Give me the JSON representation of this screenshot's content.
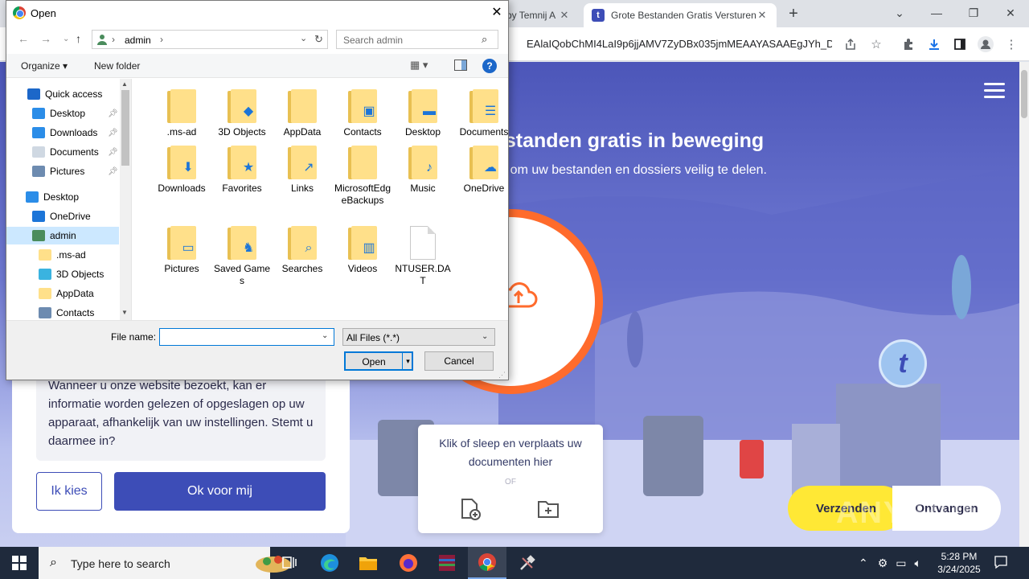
{
  "browser": {
    "tabs": [
      {
        "label": "by Temnij A",
        "active": false
      },
      {
        "label": "Grote Bestanden Gratis Versturen",
        "active": true
      }
    ],
    "new_tab": "+",
    "favicon_letter": "t",
    "window_controls": {
      "minimize": "—",
      "restore": "❐",
      "close": "✕",
      "dropdown": "⌄"
    },
    "url": "EAlaIQobChMI4LaI9p6jjAMV7ZyDBx035jmMEAAYASAAEgJYh_D...",
    "icons": [
      "share-icon",
      "star-icon",
      "extensions-icon",
      "download-icon",
      "sidepanel-icon",
      "profile-icon",
      "menu-icon"
    ]
  },
  "page": {
    "hero_title": "estanden gratis in beweging",
    "hero_subtitle": "er om uw bestanden en dossiers veilig te delen.",
    "logo_letter": "t",
    "drop_text": "Klik of sleep en verplaats uw documenten hier",
    "drop_or": "OF",
    "btn_verzenden": "Verzenden",
    "btn_ontvangen": "Ontvangen",
    "cookie_text": "Wanneer u onze website bezoekt, kan er informatie worden gelezen of opgeslagen op uw apparaat, afhankelijk van uw instellingen. Stemt u daarmee in?",
    "btn_ik_kies": "Ik kies",
    "btn_ok": "Ok voor mij",
    "watermark": "ANY RUN",
    "accent": "#3d4db7",
    "orange": "#ff6b2c",
    "yellow": "#ffe835"
  },
  "dialog": {
    "title": "Open",
    "close": "✕",
    "address": {
      "path": "admin",
      "sep": "›"
    },
    "search_placeholder": "Search admin",
    "organize": "Organize ▾",
    "new_folder": "New folder",
    "help": "?",
    "view_icon": "▦ ▾",
    "nav_items": [
      {
        "label": "Quick access",
        "icon": "star-icon",
        "color": "#1c67c9",
        "pinned": false,
        "indent": 0
      },
      {
        "label": "Desktop",
        "icon": "desktop-icon",
        "color": "#2b8de8",
        "pinned": true,
        "indent": 1
      },
      {
        "label": "Downloads",
        "icon": "downloads-icon",
        "color": "#2b8de8",
        "pinned": true,
        "indent": 1
      },
      {
        "label": "Documents",
        "icon": "documents-icon",
        "color": "#cfd8e2",
        "pinned": true,
        "indent": 1
      },
      {
        "label": "Pictures",
        "icon": "pictures-icon",
        "color": "#6d8bb0",
        "pinned": true,
        "indent": 1
      },
      {
        "label": "Desktop",
        "icon": "desktop-icon",
        "color": "#2b8de8",
        "pinned": false,
        "indent": 0
      },
      {
        "label": "OneDrive",
        "icon": "onedrive-icon",
        "color": "#1c75d8",
        "pinned": false,
        "indent": 1
      },
      {
        "label": "admin",
        "icon": "user-icon",
        "color": "#4a8c5c",
        "pinned": false,
        "indent": 1
      },
      {
        "label": ".ms-ad",
        "icon": "folder-icon",
        "color": "#ffe08a",
        "pinned": false,
        "indent": 2
      },
      {
        "label": "3D Objects",
        "icon": "3d-objects-icon",
        "color": "#3ab3e0",
        "pinned": false,
        "indent": 2
      },
      {
        "label": "AppData",
        "icon": "folder-icon",
        "color": "#ffe08a",
        "pinned": false,
        "indent": 2
      },
      {
        "label": "Contacts",
        "icon": "contacts-icon",
        "color": "#6d8bb0",
        "pinned": false,
        "indent": 2
      }
    ],
    "selected_nav": "admin",
    "files": [
      {
        "label": ".ms-ad",
        "overlay": "",
        "type": "folder"
      },
      {
        "label": "3D Objects",
        "overlay": "◆",
        "type": "folder"
      },
      {
        "label": "AppData",
        "overlay": "",
        "type": "folder"
      },
      {
        "label": "Contacts",
        "overlay": "▣",
        "type": "folder"
      },
      {
        "label": "Desktop",
        "overlay": "▬",
        "type": "folder"
      },
      {
        "label": "Documents",
        "overlay": "☰",
        "type": "folder"
      },
      {
        "label": "Downloads",
        "overlay": "⬇",
        "type": "folder"
      },
      {
        "label": "Favorites",
        "overlay": "★",
        "type": "folder"
      },
      {
        "label": "Links",
        "overlay": "↗",
        "type": "folder"
      },
      {
        "label": "MicrosoftEdgeBackups",
        "overlay": "",
        "type": "folder"
      },
      {
        "label": "Music",
        "overlay": "♪",
        "type": "folder"
      },
      {
        "label": "OneDrive",
        "overlay": "☁",
        "type": "folder"
      },
      {
        "label": "Pictures",
        "overlay": "▭",
        "type": "folder"
      },
      {
        "label": "Saved Games",
        "overlay": "♞",
        "type": "folder"
      },
      {
        "label": "Searches",
        "overlay": "⌕",
        "type": "folder"
      },
      {
        "label": "Videos",
        "overlay": "▥",
        "type": "folder"
      },
      {
        "label": "NTUSER.DAT",
        "overlay": "",
        "type": "file"
      }
    ],
    "file_name_label": "File name:",
    "file_name_value": "",
    "filter_value": "All Files (*.*)",
    "open_label": "Open",
    "cancel_label": "Cancel"
  },
  "taskbar": {
    "search_text": "Type here to search",
    "apps": [
      "task-view-icon",
      "edge-icon",
      "file-explorer-icon",
      "firefox-icon",
      "winrar-icon",
      "chrome-icon",
      "tool-icon"
    ],
    "active_app": "chrome-icon",
    "time": "5:28 PM",
    "date": "3/24/2025"
  }
}
